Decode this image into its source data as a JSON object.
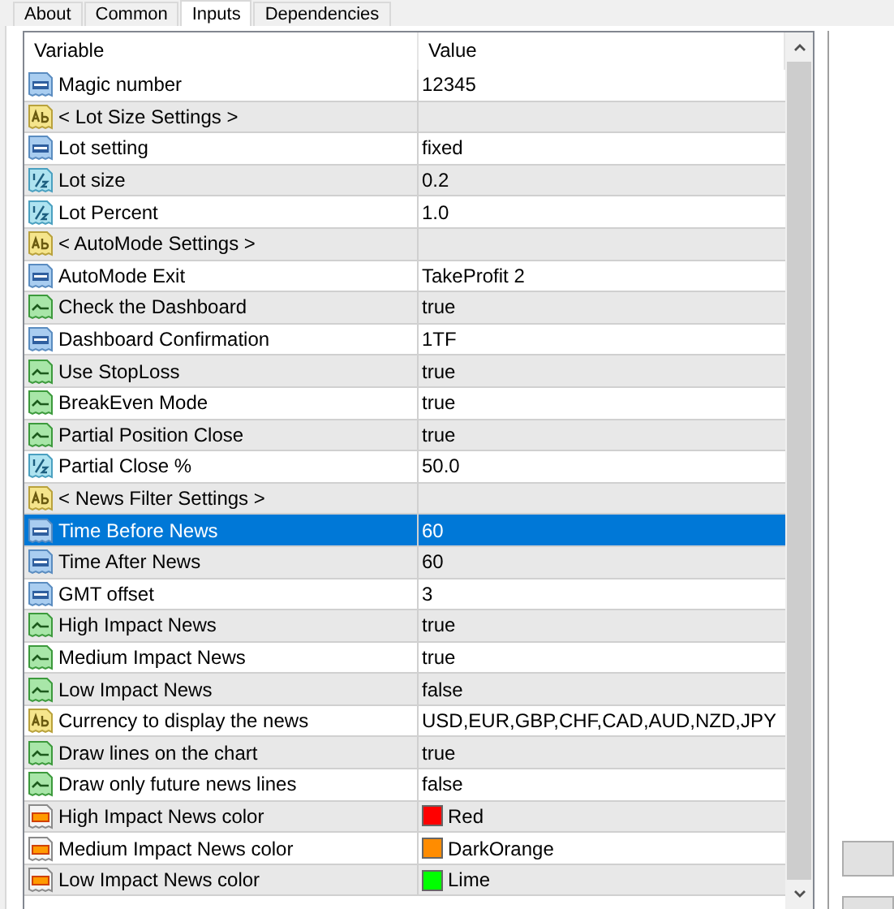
{
  "tabs": [
    {
      "label": "About",
      "selected": false
    },
    {
      "label": "Common",
      "selected": false
    },
    {
      "label": "Inputs",
      "selected": true
    },
    {
      "label": "Dependencies",
      "selected": false
    }
  ],
  "table": {
    "columns": [
      "Variable",
      "Value"
    ],
    "rows": [
      {
        "kind": "int",
        "variable": "Magic number",
        "value": "12345",
        "selected": false
      },
      {
        "kind": "string",
        "variable": "< Lot Size Settings >",
        "value": "",
        "selected": false
      },
      {
        "kind": "int",
        "variable": "Lot setting",
        "value": "fixed",
        "selected": false
      },
      {
        "kind": "double",
        "variable": "Lot size",
        "value": "0.2",
        "selected": false
      },
      {
        "kind": "double",
        "variable": "Lot Percent",
        "value": "1.0",
        "selected": false
      },
      {
        "kind": "string",
        "variable": "< AutoMode Settings >",
        "value": "",
        "selected": false
      },
      {
        "kind": "int",
        "variable": "AutoMode Exit",
        "value": "TakeProfit 2",
        "selected": false
      },
      {
        "kind": "bool",
        "variable": "Check the Dashboard",
        "value": "true",
        "selected": false
      },
      {
        "kind": "int",
        "variable": "Dashboard Confirmation",
        "value": "1TF",
        "selected": false
      },
      {
        "kind": "bool",
        "variable": "Use StopLoss",
        "value": "true",
        "selected": false
      },
      {
        "kind": "bool",
        "variable": "BreakEven Mode",
        "value": "true",
        "selected": false
      },
      {
        "kind": "bool",
        "variable": "Partial Position Close",
        "value": "true",
        "selected": false
      },
      {
        "kind": "double",
        "variable": "Partial Close %",
        "value": "50.0",
        "selected": false
      },
      {
        "kind": "string",
        "variable": "< News Filter Settings >",
        "value": "",
        "selected": false
      },
      {
        "kind": "int",
        "variable": "Time Before News",
        "value": "60",
        "selected": true
      },
      {
        "kind": "int",
        "variable": "Time After News",
        "value": "60",
        "selected": false
      },
      {
        "kind": "int",
        "variable": "GMT offset",
        "value": "3",
        "selected": false
      },
      {
        "kind": "bool",
        "variable": "High Impact News",
        "value": "true",
        "selected": false
      },
      {
        "kind": "bool",
        "variable": "Medium Impact News",
        "value": "true",
        "selected": false
      },
      {
        "kind": "bool",
        "variable": "Low Impact News",
        "value": "false",
        "selected": false
      },
      {
        "kind": "string",
        "variable": "Currency to display the news",
        "value": "USD,EUR,GBP,CHF,CAD,AUD,NZD,JPY",
        "selected": false
      },
      {
        "kind": "bool",
        "variable": "Draw lines on the chart",
        "value": "true",
        "selected": false
      },
      {
        "kind": "bool",
        "variable": "Draw only future news lines",
        "value": "false",
        "selected": false
      },
      {
        "kind": "color",
        "variable": "High Impact News color",
        "value": "Red",
        "color": "#ff0000",
        "selected": false
      },
      {
        "kind": "color",
        "variable": "Medium Impact News color",
        "value": "DarkOrange",
        "color": "#ff8c00",
        "selected": false
      },
      {
        "kind": "color",
        "variable": "Low Impact News color",
        "value": "Lime",
        "color": "#00ff00",
        "selected": false
      }
    ]
  }
}
